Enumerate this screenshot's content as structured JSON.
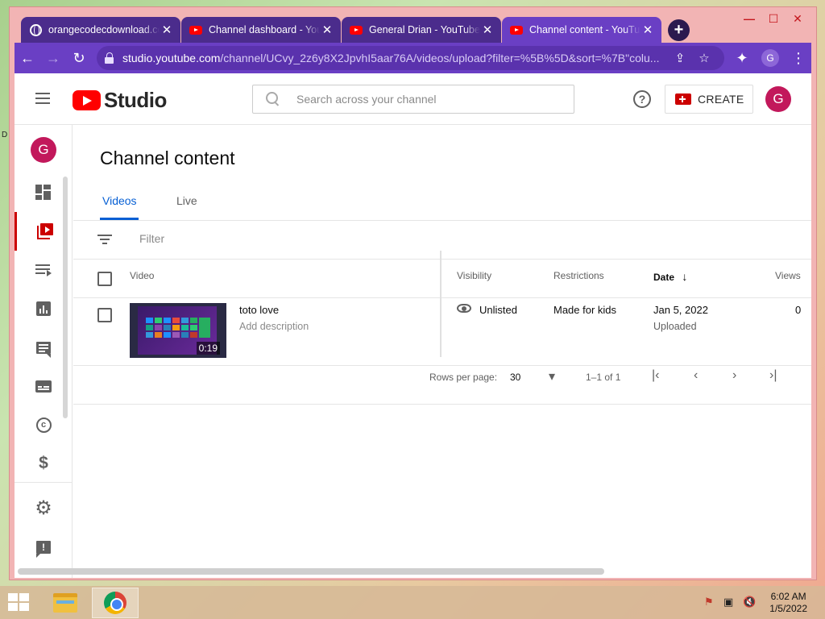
{
  "desktop": {
    "edge_text": "D"
  },
  "browser": {
    "tabs": [
      {
        "title": "orangecodecdownload.co",
        "favicon": "globe-icon",
        "active": false
      },
      {
        "title": "Channel dashboard - YouTube",
        "favicon": "youtube-icon",
        "active": false
      },
      {
        "title": "General Drian - YouTube",
        "favicon": "youtube-icon",
        "active": false
      },
      {
        "title": "Channel content - YouTube Studio",
        "favicon": "youtube-icon",
        "active": true
      }
    ],
    "new_tab_label": "+",
    "url_domain": "studio.youtube.com",
    "url_path": "/channel/UCvy_2z6y8X2JpvhI5aar76A/videos/upload?filter=%5B%5D&sort=%7B\"colu...",
    "profile_initial": "G",
    "window_controls": {
      "minimize": "—",
      "maximize": "☐",
      "close": "✕"
    }
  },
  "studio": {
    "logo_text": "Studio",
    "search_placeholder": "Search across your channel",
    "help_label": "?",
    "create_label": "CREATE",
    "avatar_initial": "G"
  },
  "sidebar": {
    "avatar_initial": "G",
    "items": [
      {
        "name": "dashboard-icon",
        "active": false
      },
      {
        "name": "content-icon",
        "active": true
      },
      {
        "name": "playlists-icon",
        "active": false
      },
      {
        "name": "analytics-icon",
        "active": false
      },
      {
        "name": "comments-icon",
        "active": false
      },
      {
        "name": "subtitles-icon",
        "active": false
      },
      {
        "name": "copyright-icon",
        "active": false
      },
      {
        "name": "monetization-icon",
        "active": false
      },
      {
        "name": "settings-icon",
        "active": false
      },
      {
        "name": "feedback-icon",
        "active": false
      }
    ],
    "copyright_glyph": "c",
    "dollar_glyph": "$",
    "gear_glyph": "⚙",
    "feedback_glyph": "!"
  },
  "content": {
    "title": "Channel content",
    "tabs": [
      {
        "label": "Videos",
        "active": true
      },
      {
        "label": "Live",
        "active": false
      }
    ],
    "filter_placeholder": "Filter",
    "columns": {
      "video": "Video",
      "visibility": "Visibility",
      "restrictions": "Restrictions",
      "date": "Date",
      "date_sort_icon": "↓",
      "views": "Views"
    },
    "rows": [
      {
        "title": "toto love",
        "description": "Add description",
        "duration": "0:19",
        "visibility": "Unlisted",
        "restrictions": "Made for kids",
        "date": "Jan 5, 2022",
        "date_status": "Uploaded",
        "views": "0"
      }
    ],
    "pagination": {
      "rows_per_page_label": "Rows per page:",
      "rows_per_page": "30",
      "dropdown_glyph": "▾",
      "range": "1–1 of 1",
      "first": "|‹",
      "prev": "‹",
      "next": "›",
      "last": "›|"
    }
  },
  "taskbar": {
    "time": "6:02 AM",
    "date": "1/5/2022"
  }
}
